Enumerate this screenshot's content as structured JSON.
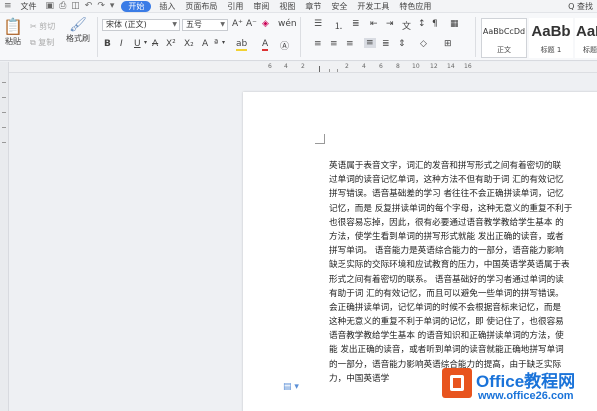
{
  "menubar": {
    "file": "文件",
    "tabs": [
      "开始",
      "插入",
      "页面布局",
      "引用",
      "审阅",
      "视图",
      "章节",
      "安全",
      "开发工具",
      "特色应用"
    ],
    "active_tab": "开始",
    "search": "Q 查找"
  },
  "ribbon": {
    "paste": "粘贴",
    "cut": "剪切",
    "copy": "复制",
    "format_painter": "格式刷",
    "font_name": "宋体 (正文)",
    "font_size": "五号",
    "styles": [
      {
        "preview": "AaBbCcDd",
        "label": "正文"
      },
      {
        "preview": "AaBb",
        "label": "标题 1"
      },
      {
        "preview": "AaBl",
        "label": "标题"
      }
    ]
  },
  "ruler": {
    "numbers": [
      "6",
      "4",
      "2",
      "2",
      "4",
      "6",
      "8",
      "10",
      "12",
      "14",
      "16"
    ]
  },
  "document": {
    "lines": [
      "英语属于表音文字，词汇的发音和拼写形式之间有着密切的联",
      "过单词的读音记忆单词，这种方法不但有助于词 汇的有效记忆",
      "拼写错误。语音基础差的学习 者往往不会正确拼读单词，记忆",
      "记忆，而是 反复拼读单词的每个字母，这种无意义的重复不利于",
      "也很容易忘掉，因此，很有必要通过语音教学教给学生基本 的",
      "方法，使学生看到单词的拼写形式就能 发出正确的读音，或者",
      "拼写单词。 语音能力是英语综合能力的一部分，语音能力影响",
      "缺乏实际的交际环境和应试教育的压力，中国英语学英语属于表",
      "形式之间有着密切的联系。 语音基础好的学习者通过单词的读",
      "有助于词 汇的有效记忆，而且可以避免一些单词的拼写错误。",
      "会正确拼读单词，记忆单词的时候不会根据音标来记忆，而是",
      "这种无意义的重复不利于单词的记忆，即 使记住了，也很容易",
      "语音教学教给学生基本 的语音知识和正确拼读单词的方法，使",
      "能 发出正确的读音，或者听到单词的读音就能正确地拼写单词",
      "的一部分，语音能力影响英语综合能力的提高，由于缺乏实际",
      "力，中国英语学"
    ]
  },
  "watermark": {
    "line1": "Office教程网",
    "line2": "www.office26.com"
  },
  "colors": {
    "accent": "#3b7ce6",
    "logo": "#e8541e",
    "watermark_text": "#1a73d9"
  }
}
